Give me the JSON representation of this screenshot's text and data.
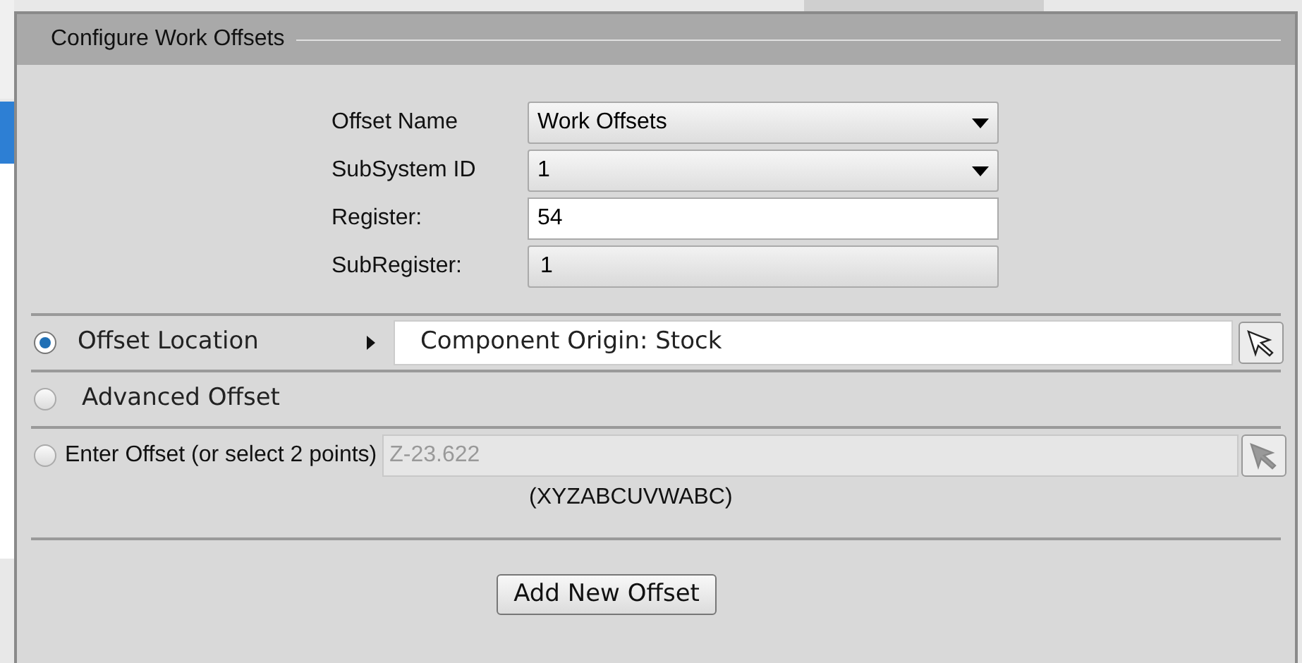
{
  "dialog": {
    "title": "Configure Work Offsets"
  },
  "fields": [
    {
      "label": "Offset Name",
      "value": "Work Offsets",
      "kind": "dropdown"
    },
    {
      "label": "SubSystem ID",
      "value": "1",
      "kind": "dropdown"
    },
    {
      "label": "Register:",
      "value": "54",
      "kind": "text"
    },
    {
      "label": "SubRegister:",
      "value": "1",
      "kind": "spin"
    }
  ],
  "options": [
    {
      "label": "Offset Location",
      "selected": true,
      "kind": "location",
      "value": "Component Origin: Stock"
    },
    {
      "label": "Advanced Offset",
      "selected": false,
      "kind": "plain"
    },
    {
      "label": "Enter Offset (or select 2 points)",
      "selected": false,
      "kind": "entry",
      "value": "Z-23.622",
      "disabled": true,
      "hint": "(XYZABCUVWABC)"
    }
  ],
  "button": "Add New Offset"
}
